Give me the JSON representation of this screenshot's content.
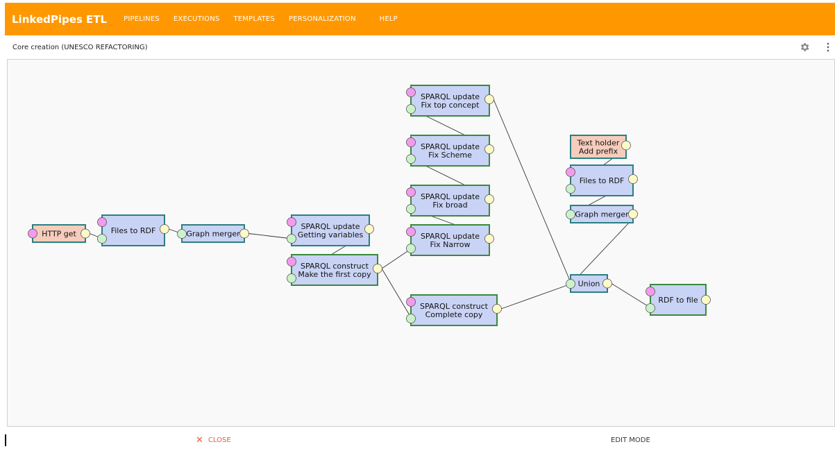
{
  "app": {
    "brand": "LinkedPipes ETL"
  },
  "nav": [
    {
      "label": "PIPELINES"
    },
    {
      "label": "EXECUTIONS"
    },
    {
      "label": "TEMPLATES"
    },
    {
      "label": "PERSONALIZATION"
    },
    {
      "label": "HELP"
    }
  ],
  "pipeline": {
    "title": "Core creation (UNESCO REFACTORING)"
  },
  "toolbar": {
    "settings_icon": "gear-icon",
    "more_icon": "more-vert-icon"
  },
  "footer": {
    "close_label": "CLOSE",
    "mode_label": "EDIT MODE"
  },
  "colors": {
    "accent": "#ff9800",
    "node_blue": "#c9d3f5",
    "node_salmon": "#f6cdbd",
    "border_green": "#3a8a3a",
    "border_teal": "#2b7f7f",
    "port_input": "#ccf2cc",
    "port_config": "#f29bec",
    "port_output": "#fff9c8",
    "close_red": "#e65d3c"
  },
  "components": [
    {
      "id": "http-get",
      "lines": [
        "HTTP get"
      ]
    },
    {
      "id": "files-to-rdf-1",
      "lines": [
        "Files to RDF"
      ]
    },
    {
      "id": "graph-merger-1",
      "lines": [
        "Graph merger"
      ]
    },
    {
      "id": "sparql-update-getting-variables",
      "lines": [
        "SPARQL update",
        "Getting variables"
      ]
    },
    {
      "id": "sparql-construct-first-copy",
      "lines": [
        "SPARQL construct",
        "Make the first copy"
      ]
    },
    {
      "id": "sparql-update-fix-top-concept",
      "lines": [
        "SPARQL update",
        "Fix top concept"
      ]
    },
    {
      "id": "sparql-update-fix-scheme",
      "lines": [
        "SPARQL update",
        "Fix Scheme"
      ]
    },
    {
      "id": "sparql-update-fix-broad",
      "lines": [
        "SPARQL update",
        "Fix broad"
      ]
    },
    {
      "id": "sparql-update-fix-narrow",
      "lines": [
        "SPARQL update",
        "Fix Narrow"
      ]
    },
    {
      "id": "sparql-construct-complete-copy",
      "lines": [
        "SPARQL construct",
        "Complete copy"
      ]
    },
    {
      "id": "text-holder-add-prefix",
      "lines": [
        "Text holder",
        "Add prefix"
      ]
    },
    {
      "id": "files-to-rdf-2",
      "lines": [
        "Files to RDF"
      ]
    },
    {
      "id": "graph-merger-2",
      "lines": [
        "Graph merger"
      ]
    },
    {
      "id": "union",
      "lines": [
        "Union"
      ]
    },
    {
      "id": "rdf-to-file",
      "lines": [
        "RDF to file"
      ]
    }
  ]
}
